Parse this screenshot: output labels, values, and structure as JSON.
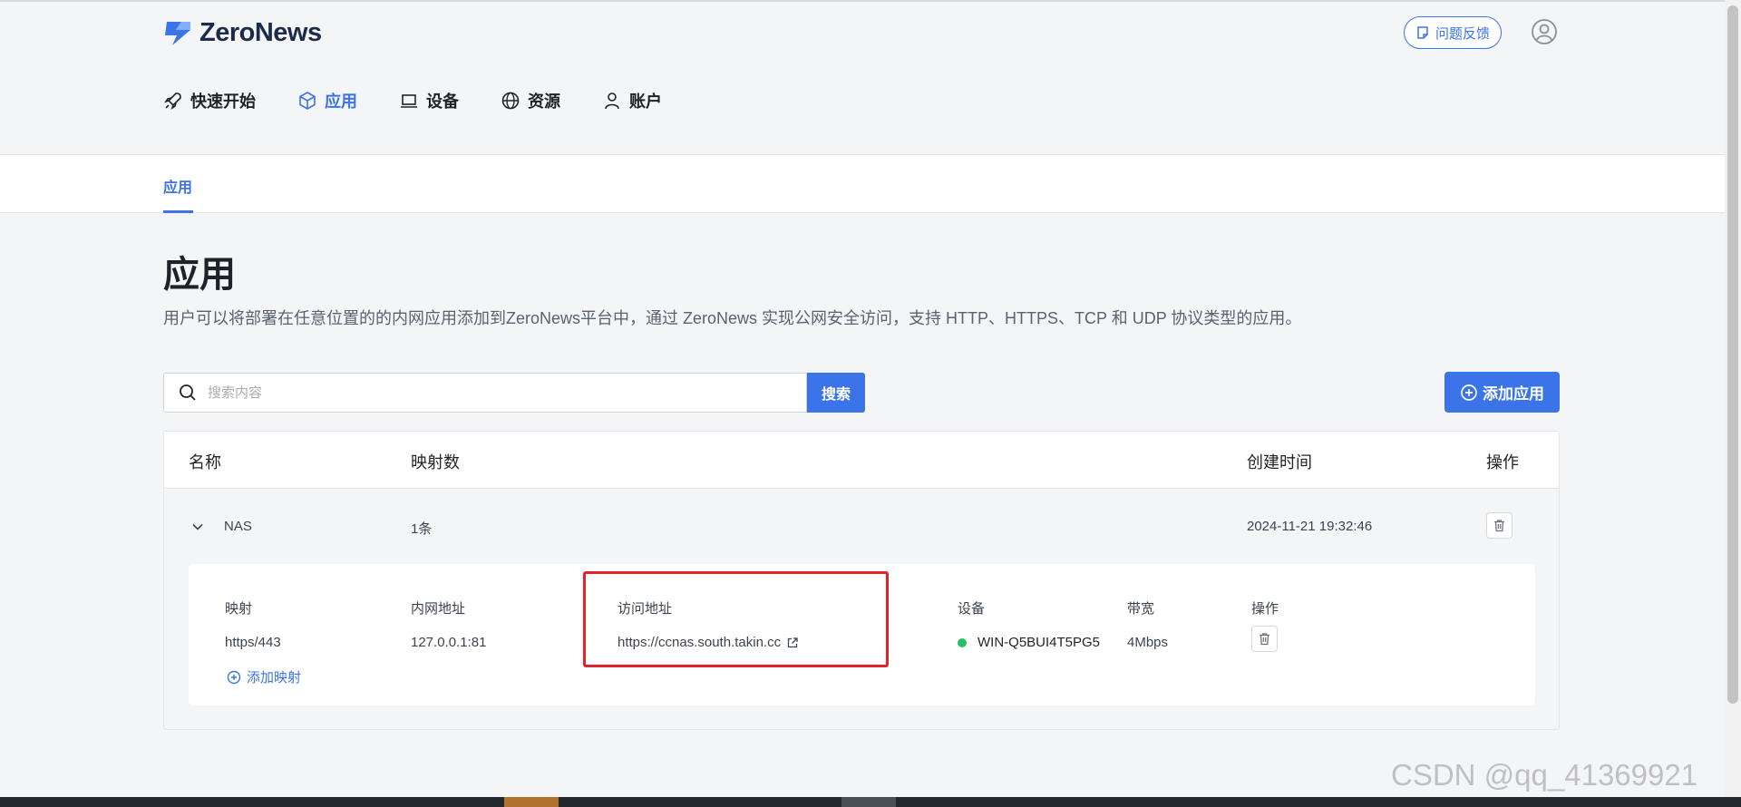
{
  "brand": {
    "name": "ZeroNews"
  },
  "header": {
    "feedback_label": "问题反馈"
  },
  "nav": {
    "items": [
      {
        "label": "快速开始",
        "icon": "rocket-icon"
      },
      {
        "label": "应用",
        "icon": "cube-icon",
        "active": true
      },
      {
        "label": "设备",
        "icon": "laptop-icon"
      },
      {
        "label": "资源",
        "icon": "globe-icon"
      },
      {
        "label": "账户",
        "icon": "user-icon"
      }
    ]
  },
  "subnav": {
    "tab_label": "应用"
  },
  "page": {
    "title": "应用",
    "description": "用户可以将部署在任意位置的的内网应用添加到ZeroNews平台中，通过 ZeroNews 实现公网安全访问，支持 HTTP、HTTPS、TCP 和 UDP 协议类型的应用。"
  },
  "search": {
    "placeholder": "搜索内容",
    "value": "",
    "button_label": "搜索"
  },
  "add_app_label": "添加应用",
  "table": {
    "columns": [
      "名称",
      "映射数",
      "创建时间",
      "操作"
    ],
    "rows": [
      {
        "name": "NAS",
        "mapping_count": "1条",
        "created_at": "2024-11-21 19:32:46",
        "detail": {
          "columns": [
            "映射",
            "内网地址",
            "访问地址",
            "设备",
            "带宽",
            "操作"
          ],
          "mapping": "https/443",
          "intranet_address": "127.0.0.1:81",
          "access_url": "https://ccnas.south.takin.cc",
          "device": "WIN-Q5BUI4T5PG5",
          "device_status_color": "#28c066",
          "bandwidth": "4Mbps",
          "add_mapping_label": "添加映射"
        }
      }
    ]
  },
  "colors": {
    "accent": "#3b73e8",
    "highlight": "#e3232b"
  },
  "watermark": "CSDN @qq_41369921"
}
